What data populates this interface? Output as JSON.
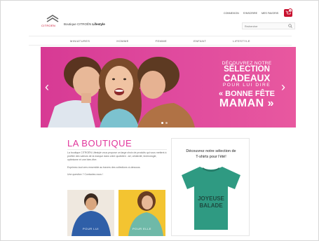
{
  "header": {
    "logo_text": "CITROËN",
    "brand_prefix": "Boutique CITROËN",
    "brand_suffix": "Lifestyle",
    "links": [
      "CONNEXION",
      "S'INSCRIRE",
      "MES FAVORIS"
    ],
    "cart_count": "0",
    "search_placeholder": "Rechercher"
  },
  "nav": {
    "items": [
      "MINIATURES",
      "HOMME",
      "FEMME",
      "ENFANT",
      "LIFESTYLE"
    ]
  },
  "hero": {
    "line1": "DÉCOUVREZ NOTRE",
    "line2": "SÉLECTION",
    "line3": "CADEAUX",
    "line4": "POUR LUI DIRE",
    "line5": "« BONNE FÊTE",
    "line6": "MAMAN »",
    "active_slide": 1,
    "slide_count": 2,
    "colors": {
      "banner": "#d73a94"
    }
  },
  "boutique": {
    "title": "LA BOUTIQUE",
    "para1": "La boutique CITROËN Lifestyle vous propose un large choix de produits qui vous mettent à profiter des valeurs de la marque dans votre quotidien : art, créativité, technologie, optimisme et une bien-être.",
    "para2": "Exprimez-tout vers ensemble au travers des collections ci-dessous.",
    "para3": "Une question ? Contactez-nous !",
    "card_left_label": "POUR LUI",
    "card_right_label": "POUR ELLE"
  },
  "promo": {
    "title_line1": "Découvrez notre sélection de",
    "title_line2": "T-shirts pour l'été!",
    "tee_print_line1": "JOYEUSE",
    "tee_print_line2": "BALADE"
  }
}
